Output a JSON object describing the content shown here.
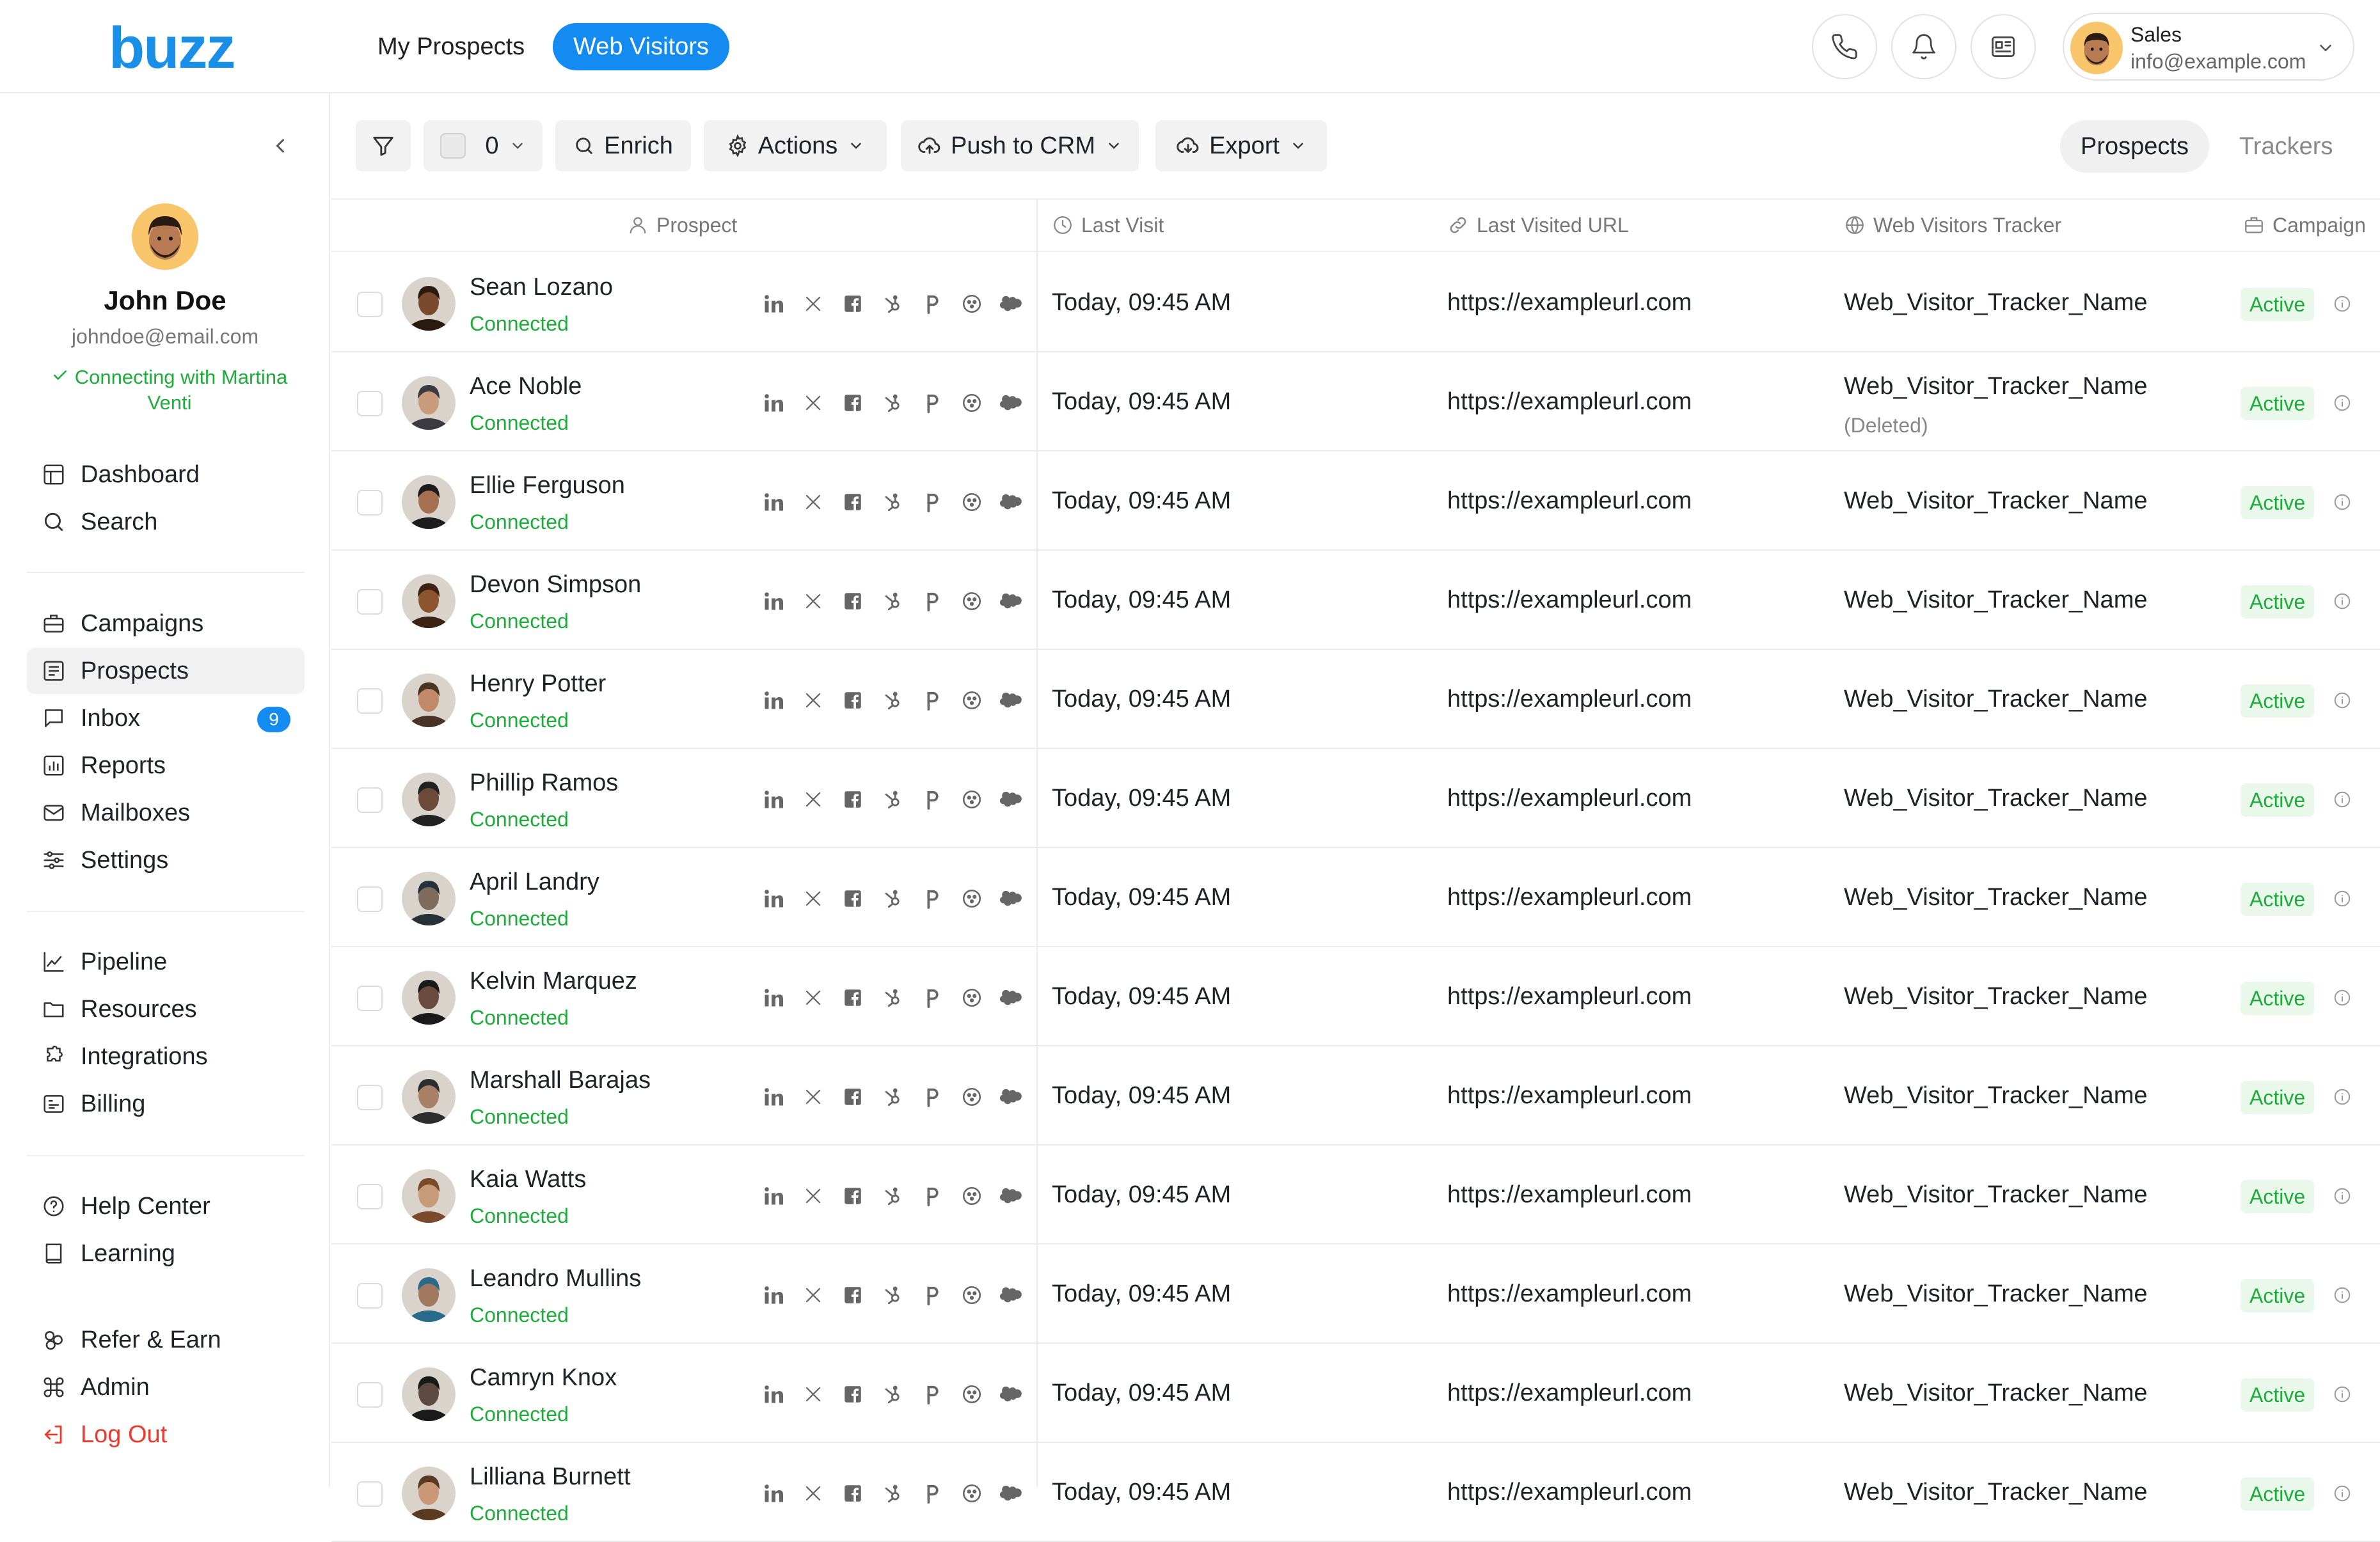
{
  "header": {
    "logo": "buzz",
    "tabs": [
      {
        "label": "My Prospects",
        "active": false
      },
      {
        "label": "Web Visitors",
        "active": true
      }
    ],
    "icons": [
      "phone-icon",
      "bell-icon",
      "news-icon"
    ],
    "user": {
      "role": "Sales",
      "email": "info@example.com"
    }
  },
  "sidebar": {
    "profile": {
      "name": "John Doe",
      "email": "johndoe@email.com",
      "status": "Connecting with Martina Venti"
    },
    "groups": [
      [
        {
          "label": "Dashboard",
          "icon": "dashboard-icon"
        },
        {
          "label": "Search",
          "icon": "search-icon"
        }
      ],
      [
        {
          "label": "Campaigns",
          "icon": "briefcase-icon"
        },
        {
          "label": "Prospects",
          "icon": "list-icon",
          "active": true
        },
        {
          "label": "Inbox",
          "icon": "chat-icon",
          "badge": "9"
        },
        {
          "label": "Reports",
          "icon": "chart-icon"
        },
        {
          "label": "Mailboxes",
          "icon": "mail-icon"
        },
        {
          "label": "Settings",
          "icon": "sliders-icon"
        }
      ],
      [
        {
          "label": "Pipeline",
          "icon": "pipeline-icon"
        },
        {
          "label": "Resources",
          "icon": "folder-icon"
        },
        {
          "label": "Integrations",
          "icon": "puzzle-icon"
        },
        {
          "label": "Billing",
          "icon": "billing-icon"
        }
      ],
      [
        {
          "label": "Help Center",
          "icon": "help-icon"
        },
        {
          "label": "Learning",
          "icon": "book-icon"
        }
      ],
      [
        {
          "label": "Refer & Earn",
          "icon": "refer-icon"
        },
        {
          "label": "Admin",
          "icon": "command-icon"
        },
        {
          "label": "Log Out",
          "icon": "logout-icon",
          "danger": true
        }
      ]
    ]
  },
  "toolbar": {
    "selected_count": "0",
    "enrich": "Enrich",
    "actions": "Actions",
    "push_crm": "Push to CRM",
    "export": "Export",
    "view_tabs": [
      {
        "label": "Prospects",
        "active": true
      },
      {
        "label": "Trackers",
        "active": false
      }
    ]
  },
  "table": {
    "columns": [
      "Prospect",
      "Last Visit",
      "Last Visited URL",
      "Web Visitors Tracker",
      "Campaign"
    ],
    "status_label": "Connected",
    "campaign_label": "Active",
    "rows": [
      {
        "name": "Sean Lozano",
        "visit": "Today, 09:45 AM",
        "url": "https://exampleurl.com",
        "tracker": "Web_Visitor_Tracker_Name",
        "skin": "#7b4a2e",
        "hair": "#2b1a10"
      },
      {
        "name": "Ace Noble",
        "visit": "Today, 09:45 AM",
        "url": "https://exampleurl.com",
        "tracker": "Web_Visitor_Tracker_Name",
        "tracker_note": "(Deleted)",
        "skin": "#c99b7a",
        "hair": "#3a3a40"
      },
      {
        "name": "Ellie Ferguson",
        "visit": "Today, 09:45 AM",
        "url": "https://exampleurl.com",
        "tracker": "Web_Visitor_Tracker_Name",
        "skin": "#a56f52",
        "hair": "#1d1d1d"
      },
      {
        "name": "Devon Simpson",
        "visit": "Today, 09:45 AM",
        "url": "https://exampleurl.com",
        "tracker": "Web_Visitor_Tracker_Name",
        "skin": "#8d5430",
        "hair": "#3b2414"
      },
      {
        "name": "Henry Potter",
        "visit": "Today, 09:45 AM",
        "url": "https://exampleurl.com",
        "tracker": "Web_Visitor_Tracker_Name",
        "skin": "#c08a68",
        "hair": "#4a3426"
      },
      {
        "name": "Phillip Ramos",
        "visit": "Today, 09:45 AM",
        "url": "https://exampleurl.com",
        "tracker": "Web_Visitor_Tracker_Name",
        "skin": "#6b4a3a",
        "hair": "#222222"
      },
      {
        "name": "April Landry",
        "visit": "Today, 09:45 AM",
        "url": "https://exampleurl.com",
        "tracker": "Web_Visitor_Tracker_Name",
        "skin": "#7f6a5e",
        "hair": "#26323a"
      },
      {
        "name": "Kelvin Marquez",
        "visit": "Today, 09:45 AM",
        "url": "https://exampleurl.com",
        "tracker": "Web_Visitor_Tracker_Name",
        "skin": "#6a4a3e",
        "hair": "#1a1a1a"
      },
      {
        "name": "Marshall Barajas",
        "visit": "Today, 09:45 AM",
        "url": "https://exampleurl.com",
        "tracker": "Web_Visitor_Tracker_Name",
        "skin": "#a88068",
        "hair": "#2e2e2e"
      },
      {
        "name": "Kaia Watts",
        "visit": "Today, 09:45 AM",
        "url": "https://exampleurl.com",
        "tracker": "Web_Visitor_Tracker_Name",
        "skin": "#c79a78",
        "hair": "#7a4a2a"
      },
      {
        "name": "Leandro Mullins",
        "visit": "Today, 09:45 AM",
        "url": "https://exampleurl.com",
        "tracker": "Web_Visitor_Tracker_Name",
        "skin": "#a07860",
        "hair": "#2a6a8a"
      },
      {
        "name": "Camryn Knox",
        "visit": "Today, 09:45 AM",
        "url": "https://exampleurl.com",
        "tracker": "Web_Visitor_Tracker_Name",
        "skin": "#5e4a40",
        "hair": "#1a1a1a"
      },
      {
        "name": "Lilliana Burnett",
        "visit": "Today, 09:45 AM",
        "url": "https://exampleurl.com",
        "tracker": "Web_Visitor_Tracker_Name",
        "skin": "#c99878",
        "hair": "#5a3a22"
      }
    ],
    "social_icons": [
      "linkedin-icon",
      "x-icon",
      "facebook-icon",
      "hubspot-icon",
      "pipedrive-icon",
      "crm-icon",
      "salesforce-icon"
    ]
  },
  "colors": {
    "brand": "#138bf0",
    "success": "#1eac3b",
    "danger": "#ea3b2e"
  }
}
